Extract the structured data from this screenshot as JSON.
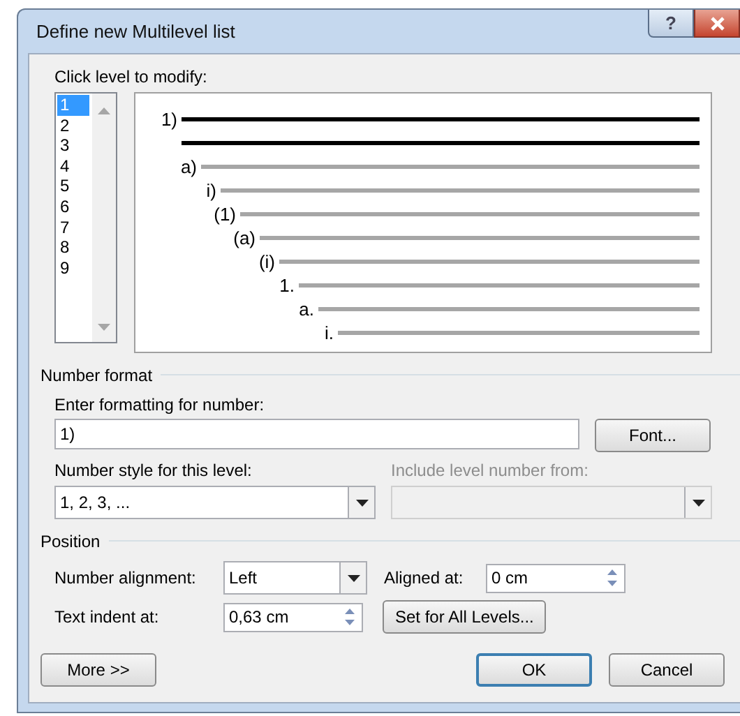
{
  "window": {
    "title": "Define new Multilevel list",
    "help_button": "?"
  },
  "levels": {
    "label": "Click level to modify:",
    "items": [
      {
        "label": "1",
        "selected": true
      },
      {
        "label": "2",
        "selected": false
      },
      {
        "label": "3",
        "selected": false
      },
      {
        "label": "4",
        "selected": false
      },
      {
        "label": "5",
        "selected": false
      },
      {
        "label": "6",
        "selected": false
      },
      {
        "label": "7",
        "selected": false
      },
      {
        "label": "8",
        "selected": false
      },
      {
        "label": "9",
        "selected": false
      }
    ]
  },
  "preview": [
    {
      "number": "1)",
      "highlighted": true
    },
    {
      "highlighted": true
    },
    {
      "number": "a)",
      "highlighted": false
    },
    {
      "number": "i)",
      "highlighted": false
    },
    {
      "number": "(1)",
      "highlighted": false
    },
    {
      "number": "(a)",
      "highlighted": false
    },
    {
      "number": "(i)",
      "highlighted": false
    },
    {
      "number": "1.",
      "highlighted": false
    },
    {
      "number": "a.",
      "highlighted": false
    },
    {
      "number": "i.",
      "highlighted": false
    }
  ],
  "number_format": {
    "heading": "Number format",
    "format_label": "Enter formatting for number:",
    "format_value": "1)",
    "font_button": "Font...",
    "style_label": "Number style for this level:",
    "style_value": "1, 2, 3, ...",
    "include_label": "Include level number from:",
    "include_disabled": true
  },
  "position": {
    "heading": "Position",
    "alignment_label": "Number alignment:",
    "alignment_value": "Left",
    "aligned_at_label": "Aligned at:",
    "aligned_at_value": "0 cm",
    "indent_label": "Text indent at:",
    "indent_value": "0,63 cm",
    "set_all_button": "Set for All Levels..."
  },
  "buttons": [
    {
      "label": "More >>",
      "default": false
    },
    {
      "label": "OK",
      "default": true
    },
    {
      "label": "Cancel",
      "default": false
    }
  ]
}
